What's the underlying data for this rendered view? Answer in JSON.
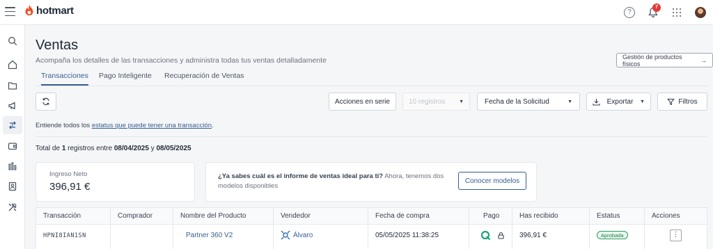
{
  "app": {
    "name": "hotmart",
    "brand_color": "#f04e23",
    "accent": "#355e91"
  },
  "header": {
    "notification_count": "7",
    "help_label": "?"
  },
  "sidebar": {
    "items": [
      {
        "icon": "search-icon"
      },
      {
        "icon": "home-icon"
      },
      {
        "icon": "folder-icon"
      },
      {
        "icon": "megaphone-icon"
      },
      {
        "icon": "sales-icon",
        "active": true
      },
      {
        "icon": "wallet-icon"
      },
      {
        "icon": "bar-chart-icon"
      },
      {
        "icon": "contacts-icon"
      },
      {
        "icon": "tools-icon"
      }
    ]
  },
  "page": {
    "title": "Ventas",
    "subtitle": "Acompaña los detalles de las transacciones y administra todas tus ventas detalladamente",
    "gestion_label": "Gestión de productos físicos"
  },
  "tabs": [
    {
      "label": "Transacciones",
      "active": true
    },
    {
      "label": "Pago Inteligente"
    },
    {
      "label": "Recuperación de Ventas"
    }
  ],
  "toolbar": {
    "acciones_label": "Acciones en serie",
    "registros_label": "10 registros",
    "fecha_label": "Fecha de la Solicitud",
    "exportar_label": "Exportar",
    "filtros_label": "Filtros"
  },
  "info": {
    "prefix": "Entiende todos los ",
    "link": "estatus que puede tener una transacción",
    "suffix": "."
  },
  "total": {
    "prefix": "Total de ",
    "count": "1",
    "middle": " registros entre ",
    "date_from": "08/04/2025",
    "conj": " y ",
    "date_to": "08/05/2025"
  },
  "ingreso": {
    "label": "Ingreso Neto",
    "value": "396,91 €"
  },
  "promo": {
    "question": "¿Ya sabes cuál es el informe de ventas ideal para ti?",
    "text": " Ahora, tenemos dos modelos disponibles",
    "button": "Conocer modelos"
  },
  "table": {
    "headers": [
      "Transacción",
      "Comprador",
      "Nombre del Producto",
      "Vendedor",
      "Fecha de compra",
      "Pago",
      "Has recibido",
      "Estatus",
      "Acciones"
    ],
    "rows": [
      {
        "transaction": "HPNI8IAN1SN",
        "buyer": "",
        "product": "Partner 360 V2",
        "seller": "Álvaro",
        "date": "05/05/2025 11:38:25",
        "payment_icon": "payment-method-icon",
        "received": "396,91 €",
        "status": "Aprobada",
        "status_color": "#2e9d5b"
      }
    ]
  }
}
